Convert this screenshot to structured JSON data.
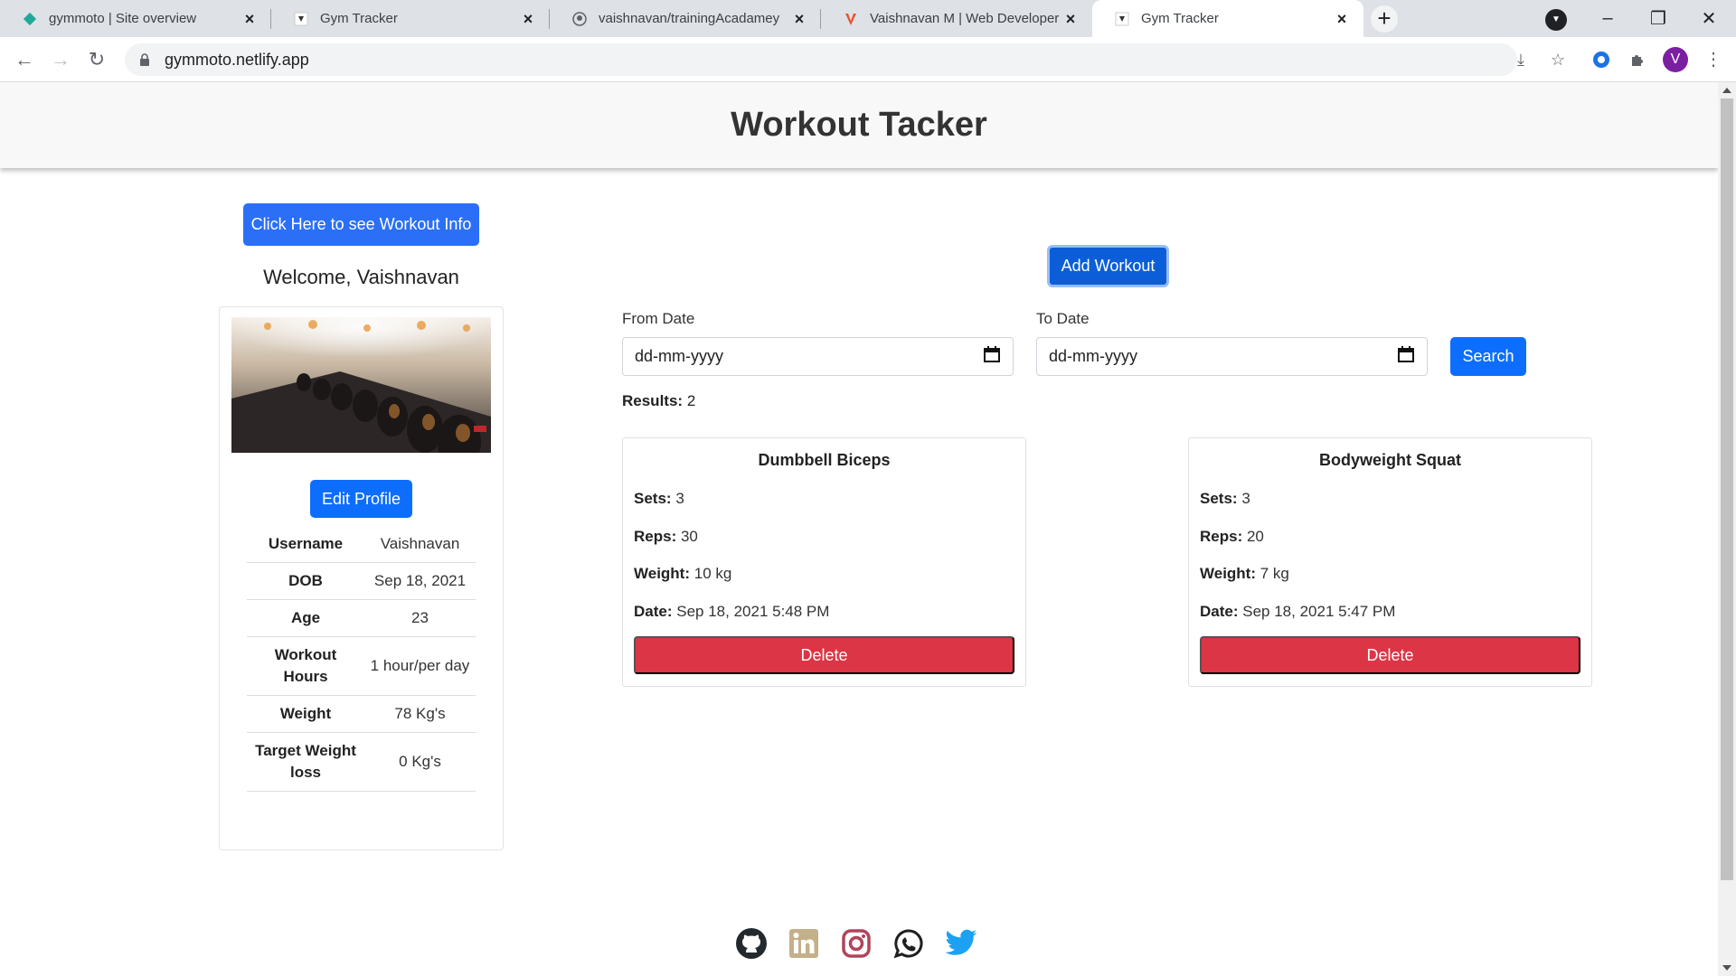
{
  "tabs": [
    {
      "title": "gymmoto | Site overview",
      "icon": "netlify-icon"
    },
    {
      "title": "Gym Tracker",
      "icon": "gym-favicon"
    },
    {
      "title": "vaishnavan/trainingAcadamey",
      "icon": "github-icon"
    },
    {
      "title": "Vaishnavan M | Web Developer",
      "icon": "v-logo-icon"
    },
    {
      "title": "Gym Tracker",
      "icon": "gym-favicon"
    }
  ],
  "address": {
    "url": "gymmoto.netlify.app"
  },
  "profile_avatar_letter": "V",
  "header": {
    "title": "Workout Tacker"
  },
  "sidebar": {
    "workout_info_button": "Click Here to see Workout Info",
    "welcome": "Welcome, Vaishnavan",
    "edit_profile_button": "Edit Profile",
    "rows": [
      {
        "label": "Username",
        "value": "Vaishnavan"
      },
      {
        "label": "DOB",
        "value": "Sep 18, 2021"
      },
      {
        "label": "Age",
        "value": "23"
      },
      {
        "label": "Workout Hours",
        "value": "1 hour/per day"
      },
      {
        "label": "Weight",
        "value": "78 Kg's"
      },
      {
        "label": "Target Weight loss",
        "value": "0 Kg's"
      }
    ]
  },
  "main": {
    "add_workout_button": "Add Workout",
    "from_date_label": "From Date",
    "from_date_value": "dd-mm-yyyy",
    "to_date_label": "To Date",
    "to_date_value": "dd-mm-yyyy",
    "search_button": "Search",
    "results_label": "Results:",
    "results_count": "2",
    "labels": {
      "sets": "Sets:",
      "reps": "Reps:",
      "weight": "Weight:",
      "date": "Date:"
    },
    "delete_label": "Delete",
    "workouts": [
      {
        "name": "Dumbbell Biceps",
        "sets": "3",
        "reps": "30",
        "weight": "10 kg",
        "date": "Sep 18, 2021 5:48 PM"
      },
      {
        "name": "Bodyweight Squat",
        "sets": "3",
        "reps": "20",
        "weight": "7 kg",
        "date": "Sep 18, 2021 5:47 PM"
      }
    ]
  },
  "footer": {
    "social_icons": [
      "github-icon",
      "linkedin-icon",
      "instagram-icon",
      "whatsapp-icon",
      "twitter-icon"
    ]
  },
  "colors": {
    "primary": "#0d6efd",
    "danger": "#dc3545",
    "header_bg": "#f8f8f8",
    "linkedin": "#c4b089",
    "instagram": "#b0445a",
    "twitter": "#1da1f2"
  }
}
